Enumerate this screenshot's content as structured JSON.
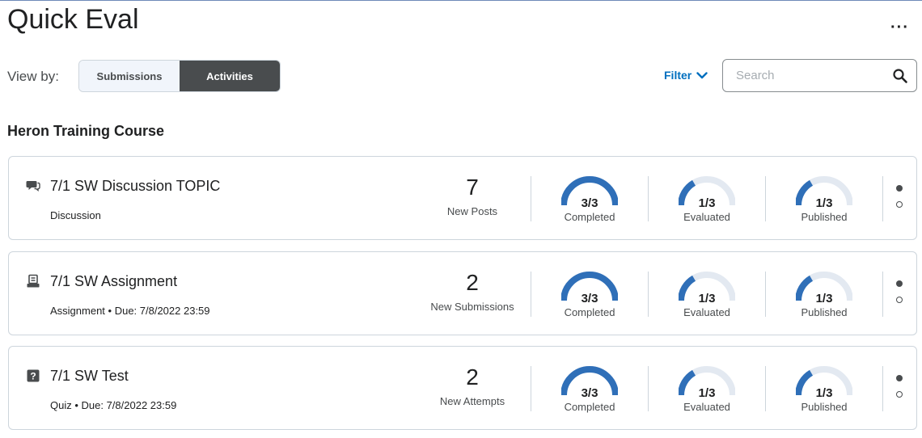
{
  "page": {
    "title": "Quick Eval",
    "more_label": "···"
  },
  "view_by": {
    "label": "View by:",
    "options": [
      "Submissions",
      "Activities"
    ],
    "selected": "Activities"
  },
  "filter": {
    "label": "Filter"
  },
  "search": {
    "placeholder": "Search"
  },
  "course": {
    "name": "Heron Training Course"
  },
  "colors": {
    "accent": "#006fbf",
    "gauge_fill": "#2f6fb8",
    "gauge_track": "#e3e9f1",
    "active_toggle": "#494c4e"
  },
  "activities": [
    {
      "icon": "discussion-icon",
      "title": "7/1 SW Discussion TOPIC",
      "subtitle": "Discussion",
      "count": "7",
      "count_label": "New Posts",
      "completed": {
        "value": "3/3",
        "label": "Completed",
        "fraction": 1.0
      },
      "evaluated": {
        "value": "1/3",
        "label": "Evaluated",
        "fraction": 0.3333
      },
      "published": {
        "value": "1/3",
        "label": "Published",
        "fraction": 0.3333
      }
    },
    {
      "icon": "assignment-icon",
      "title": "7/1 SW Assignment",
      "subtitle": "Assignment • Due: 7/8/2022 23:59",
      "count": "2",
      "count_label": "New Submissions",
      "completed": {
        "value": "3/3",
        "label": "Completed",
        "fraction": 1.0
      },
      "evaluated": {
        "value": "1/3",
        "label": "Evaluated",
        "fraction": 0.3333
      },
      "published": {
        "value": "1/3",
        "label": "Published",
        "fraction": 0.3333
      }
    },
    {
      "icon": "quiz-icon",
      "title": "7/1 SW Test",
      "subtitle": "Quiz • Due: 7/8/2022 23:59",
      "count": "2",
      "count_label": "New Attempts",
      "completed": {
        "value": "3/3",
        "label": "Completed",
        "fraction": 1.0
      },
      "evaluated": {
        "value": "1/3",
        "label": "Evaluated",
        "fraction": 0.3333
      },
      "published": {
        "value": "1/3",
        "label": "Published",
        "fraction": 0.3333
      }
    }
  ]
}
